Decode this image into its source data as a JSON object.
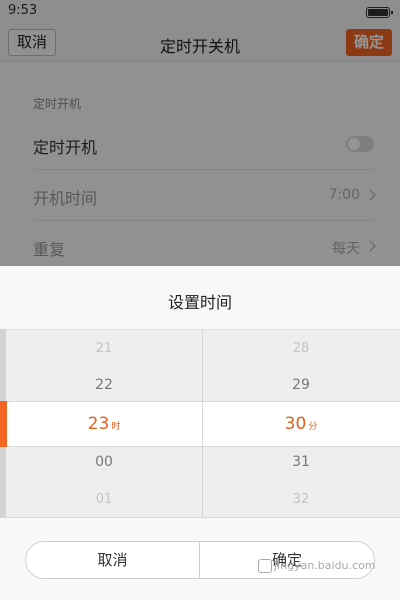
{
  "status_bar": {
    "time": "9:53"
  },
  "header": {
    "cancel_label": "取消",
    "title": "定时开关机",
    "confirm_label": "确定"
  },
  "settings": {
    "section_title": "定时开机",
    "power_on_label": "定时开机",
    "power_on_enabled": false,
    "power_on_time_label": "开机时间",
    "power_on_time_value": "7:00",
    "repeat_label": "重复",
    "repeat_value": "每天"
  },
  "dialog": {
    "title": "设置时间",
    "hours": {
      "above_far": "21",
      "above_near": "22",
      "selected": "23",
      "unit": "时",
      "below_near": "00",
      "below_far": "01"
    },
    "minutes": {
      "above_far": "28",
      "above_near": "29",
      "selected": "30",
      "unit": "分",
      "below_near": "31",
      "below_far": "32"
    },
    "cancel_label": "取消",
    "confirm_label": "确定"
  },
  "watermark": {
    "text": "jingyan.baidu.com"
  },
  "colors": {
    "accent": "#f26522",
    "selected_text": "#e0601e"
  }
}
